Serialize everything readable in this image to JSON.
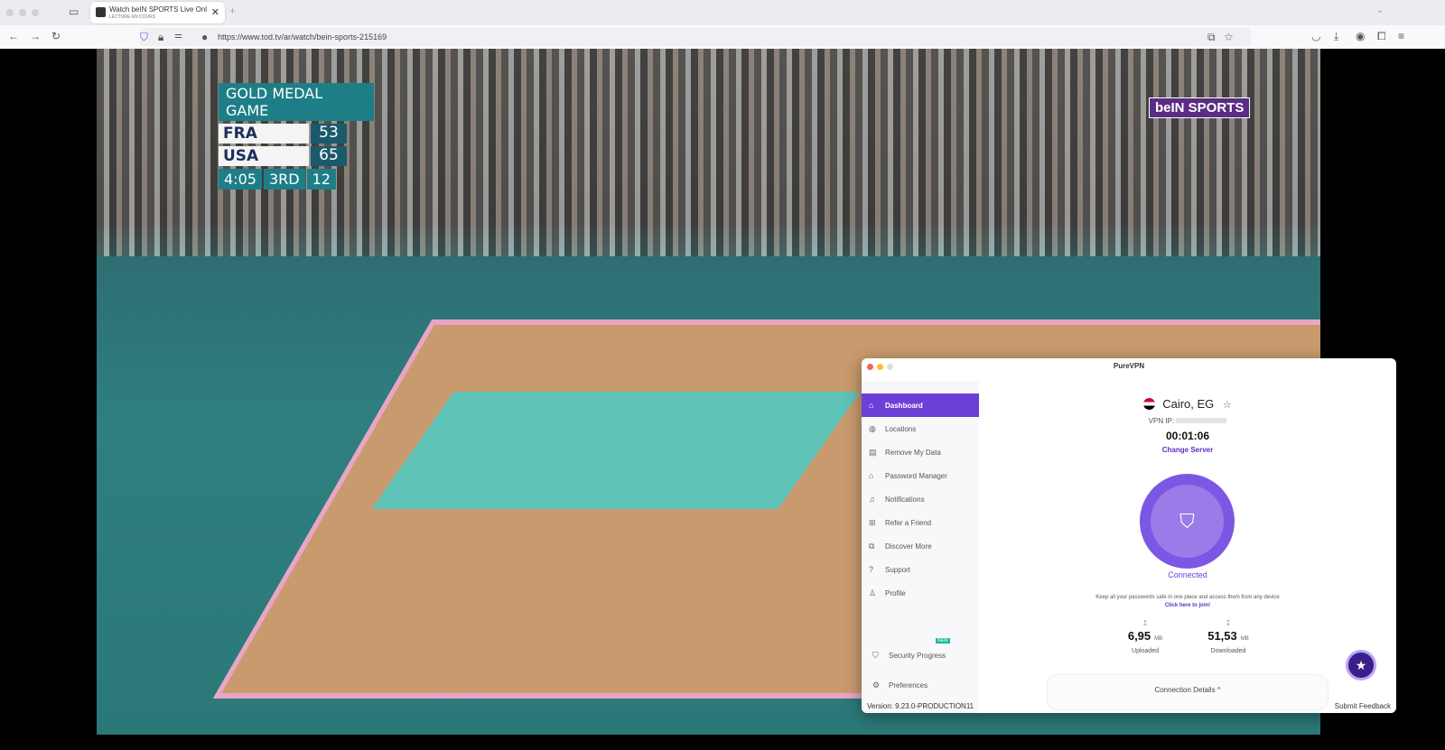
{
  "browser": {
    "tab_title": "Watch beIN SPORTS Live Online",
    "tab_subtitle": "LECTURE EN COURS",
    "url": "https://www.tod.tv/ar/watch/bein-sports-215169"
  },
  "video": {
    "scoreboard": {
      "title": "GOLD MEDAL GAME",
      "teams": [
        {
          "name": "FRA",
          "score": "53"
        },
        {
          "name": "USA",
          "score": "65"
        }
      ],
      "clock": "4:05",
      "period": "3RD",
      "shot_clock": "12"
    },
    "channel_logo": "beIN SPORTS"
  },
  "vpn": {
    "window_title": "PureVPN",
    "nav": [
      {
        "label": "Dashboard",
        "icon": "home-icon"
      },
      {
        "label": "Locations",
        "icon": "globe-icon"
      },
      {
        "label": "Remove My Data",
        "icon": "document-icon"
      },
      {
        "label": "Password Manager",
        "icon": "lock-icon"
      },
      {
        "label": "Notifications",
        "icon": "bell-icon"
      },
      {
        "label": "Refer a Friend",
        "icon": "gift-icon"
      },
      {
        "label": "Discover More",
        "icon": "discover-icon"
      },
      {
        "label": "Support",
        "icon": "help-icon"
      },
      {
        "label": "Profile",
        "icon": "user-icon"
      }
    ],
    "security_progress": "Security Progress",
    "new_badge": "NEW",
    "preferences": "Preferences",
    "location": "Cairo, EG",
    "vpn_ip_label": "VPN IP:",
    "timer": "00:01:06",
    "change_server": "Change Server",
    "status": "Connected",
    "promo": "Keep all your passwords safe in one place and access them from any device",
    "promo_link": "Click here to join!",
    "uploaded": {
      "value": "6,95",
      "unit": "MB",
      "label": "Uploaded"
    },
    "downloaded": {
      "value": "51,53",
      "unit": "MB",
      "label": "Downloaded"
    },
    "connection_details": "Connection Details ^",
    "version": "Version: 9.23.0-PRODUCTION11",
    "submit_feedback": "Submit Feedback",
    "accent": "#6c3fd6"
  }
}
